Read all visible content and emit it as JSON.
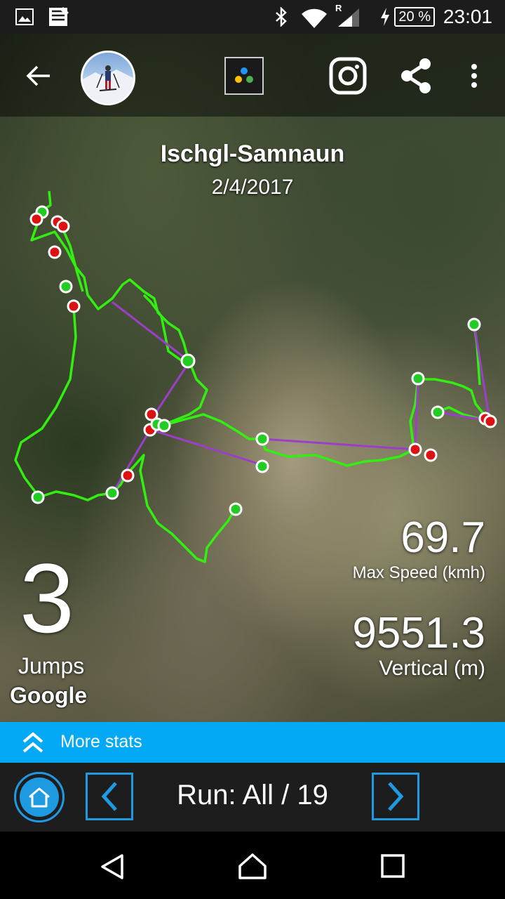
{
  "status_bar": {
    "time": "23:01",
    "battery": "20 %",
    "roaming": "R",
    "icons": [
      "image-icon",
      "notification-icon",
      "bluetooth-icon",
      "wifi-icon",
      "signal-icon",
      "charging-icon"
    ]
  },
  "toolbar": {
    "icons": [
      "back-arrow-icon",
      "profile-avatar",
      "app-launcher-icon",
      "instagram-icon",
      "share-icon",
      "more-vert-icon"
    ]
  },
  "resort": {
    "name": "Ischgl-Samnaun",
    "date": "2/4/2017"
  },
  "stats": {
    "jumps_value": "3",
    "jumps_label": "Jumps",
    "max_speed_value": "69.7",
    "max_speed_label": "Max Speed (kmh)",
    "vertical_value": "9551.3",
    "vertical_label": "Vertical (m)"
  },
  "map": {
    "attribution": "Google",
    "route_color": "#33ee11",
    "lift_color": "#9b3fc9",
    "start_marker_color": "#22cc22",
    "end_marker_color": "#dd1111"
  },
  "more_stats": {
    "label": "More stats",
    "color": "#03a9f4"
  },
  "run_nav": {
    "label": "Run: All / 19",
    "accent": "#1e9be0"
  },
  "nav_bar": {
    "icons": [
      "back-triangle-icon",
      "home-icon",
      "recents-icon"
    ]
  }
}
